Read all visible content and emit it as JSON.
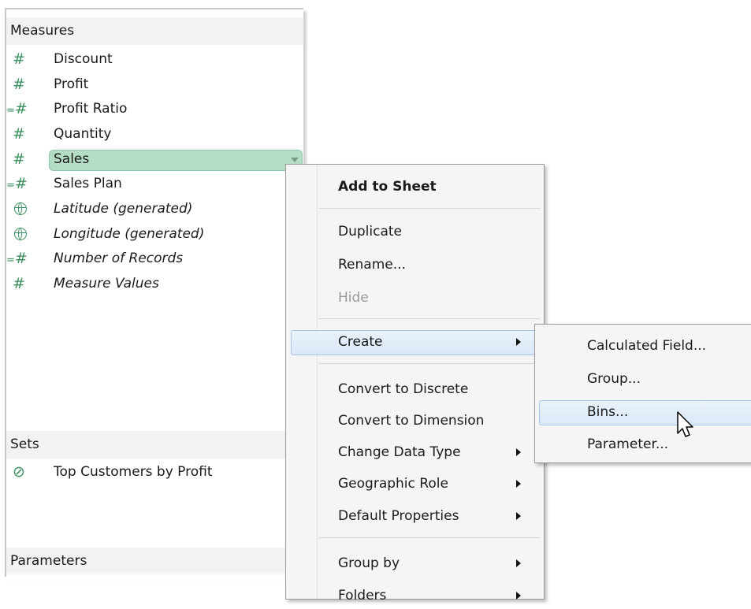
{
  "data_pane": {
    "measures_header": "Measures",
    "measures": [
      {
        "label": "Discount",
        "icon": "number-icon",
        "italic": false
      },
      {
        "label": "Profit",
        "icon": "number-icon",
        "italic": false
      },
      {
        "label": "Profit Ratio",
        "icon": "calculated-number-icon",
        "italic": false
      },
      {
        "label": "Quantity",
        "icon": "number-icon",
        "italic": false
      },
      {
        "label": "Sales",
        "icon": "number-icon",
        "italic": false,
        "selected": true
      },
      {
        "label": "Sales Plan",
        "icon": "calculated-number-icon",
        "italic": false
      },
      {
        "label": "Latitude (generated)",
        "icon": "globe-icon",
        "italic": true
      },
      {
        "label": "Longitude (generated)",
        "icon": "globe-icon",
        "italic": true
      },
      {
        "label": "Number of Records",
        "icon": "calculated-number-icon",
        "italic": true
      },
      {
        "label": "Measure Values",
        "icon": "number-icon",
        "italic": true
      }
    ],
    "sets_header": "Sets",
    "sets": [
      {
        "label": "Top Customers by Profit",
        "icon": "set-icon"
      }
    ],
    "parameters_header": "Parameters"
  },
  "context_menu": {
    "items": [
      {
        "label": "Add to Sheet",
        "bold": true
      },
      {
        "label": "Duplicate"
      },
      {
        "label": "Rename..."
      },
      {
        "label": "Hide",
        "disabled": true
      },
      {
        "label": "Create",
        "submenu": true,
        "highlighted": true
      },
      {
        "label": "Convert to Discrete"
      },
      {
        "label": "Convert to Dimension"
      },
      {
        "label": "Change Data Type",
        "submenu": true
      },
      {
        "label": "Geographic Role",
        "submenu": true
      },
      {
        "label": "Default Properties",
        "submenu": true
      },
      {
        "label": "Group by",
        "submenu": true
      },
      {
        "label": "Folders",
        "submenu": true
      }
    ]
  },
  "create_submenu": {
    "items": [
      {
        "label": "Calculated Field..."
      },
      {
        "label": "Group..."
      },
      {
        "label": "Bins...",
        "highlighted": true
      },
      {
        "label": "Parameter..."
      }
    ]
  },
  "colors": {
    "measure_icon": "#3b8f5e",
    "selected_pill": "#b5dcc5",
    "menu_highlight": "#dbe8f7",
    "set_icon": "#3a78c2"
  }
}
